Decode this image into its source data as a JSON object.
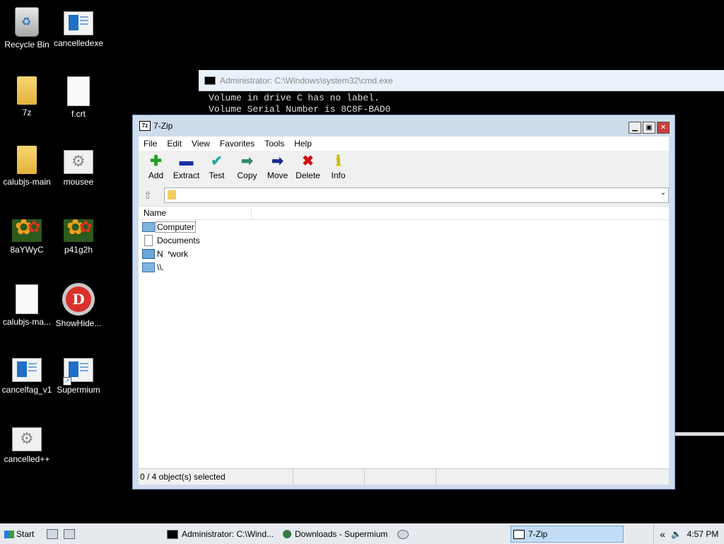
{
  "desktop": {
    "icons": [
      {
        "label": "Recycle Bin"
      },
      {
        "label": "cancelledexe"
      },
      {
        "label": "7z"
      },
      {
        "label": "f.crt"
      },
      {
        "label": "calubjs-main"
      },
      {
        "label": "mousee"
      },
      {
        "label": "8aYWyC"
      },
      {
        "label": "p41g2h"
      },
      {
        "label": "calubjs-ma..."
      },
      {
        "label": "ShowHide..."
      },
      {
        "label": "cancelfag_v1"
      },
      {
        "label": "Supermium"
      },
      {
        "label": "cancelled++"
      }
    ]
  },
  "console": {
    "title": "Administrator: C:\\Windows\\system32\\cmd.exe",
    "lines": [
      "Volume in drive C has no label.",
      "Volume Serial Number is 8C8F-BAD0"
    ]
  },
  "zip": {
    "title": "7-Zip",
    "app_icon_text": "7z",
    "menu": [
      "File",
      "Edit",
      "View",
      "Favorites",
      "Tools",
      "Help"
    ],
    "toolbar": [
      {
        "label": "Add",
        "glyph": "✚",
        "color": "#1fa01f"
      },
      {
        "label": "Extract",
        "glyph": "▬",
        "color": "#1a2fa8"
      },
      {
        "label": "Test",
        "glyph": "✔",
        "color": "#2aa8a8"
      },
      {
        "label": "Copy",
        "glyph": "➡",
        "color": "#2a8a6a"
      },
      {
        "label": "Move",
        "glyph": "➡",
        "color": "#1a2a8a"
      },
      {
        "label": "Delete",
        "glyph": "✖",
        "color": "#d01010"
      },
      {
        "label": "Info",
        "glyph": "ℹ",
        "color": "#c8b800"
      }
    ],
    "address_value": "",
    "column_name": "Name",
    "rows": [
      {
        "name": "Computer",
        "icon": "computer-icon"
      },
      {
        "name": "Documents",
        "icon": "document-icon"
      },
      {
        "name": "Network",
        "icon": "network-icon"
      },
      {
        "name": "\\\\.",
        "icon": "computer-icon"
      }
    ],
    "status": "0 / 4 object(s) selected"
  },
  "taskbar": {
    "start_label": "Start",
    "tasks": [
      {
        "label": "Administrator: C:\\Wind..."
      },
      {
        "label": "Downloads - Supermium"
      },
      {
        "label": "7-Zip"
      }
    ],
    "tray_chevron": "«",
    "clock": "4:57 PM"
  }
}
